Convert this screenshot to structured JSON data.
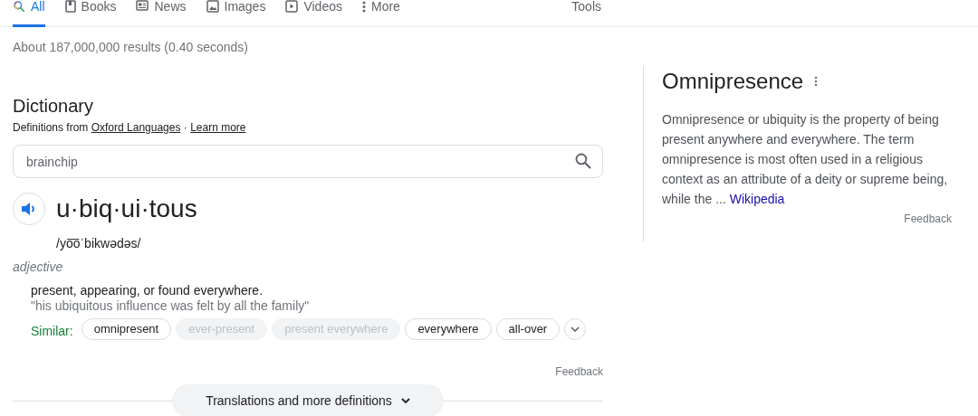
{
  "tabs": [
    {
      "label": "All",
      "kind": "search",
      "selected": true
    },
    {
      "label": "Books",
      "kind": "book",
      "selected": false
    },
    {
      "label": "News",
      "kind": "news",
      "selected": false
    },
    {
      "label": "Images",
      "kind": "image",
      "selected": false
    },
    {
      "label": "Videos",
      "kind": "video",
      "selected": false
    },
    {
      "label": "More",
      "kind": "more",
      "selected": false
    }
  ],
  "tools": "Tools",
  "result_stats": "About 187,000,000 results (0.40 seconds)",
  "dictionary": {
    "title": "Dictionary",
    "source_prefix": "Definitions from",
    "source_link": "Oxford Languages",
    "separator": "·",
    "learn_more": "Learn more",
    "search": {
      "value": "brainchip"
    },
    "word": "u·biq·ui·tous",
    "phonetic": "/yo͞oˈbikwədəs/",
    "part_of_speech": "adjective",
    "definition": "present, appearing, or found everywhere.",
    "example": "\"his ubiquitous influence was felt by all the family\"",
    "similar_label": "Similar:",
    "similar": [
      {
        "label": "omnipresent",
        "disabled": false
      },
      {
        "label": "ever-present",
        "disabled": true
      },
      {
        "label": "present everywhere",
        "disabled": true
      },
      {
        "label": "everywhere",
        "disabled": false
      },
      {
        "label": "all-over",
        "disabled": false
      }
    ],
    "feedback": "Feedback",
    "more_button": "Translations and more definitions"
  },
  "knowledge_panel": {
    "title": "Omnipresence",
    "description": "Omnipresence or ubiquity is the property of being present anywhere and everywhere. The term omnipresence is most often used in a religious context as an attribute of a deity or supreme being, while the ...",
    "source_link": "Wikipedia",
    "feedback": "Feedback"
  }
}
